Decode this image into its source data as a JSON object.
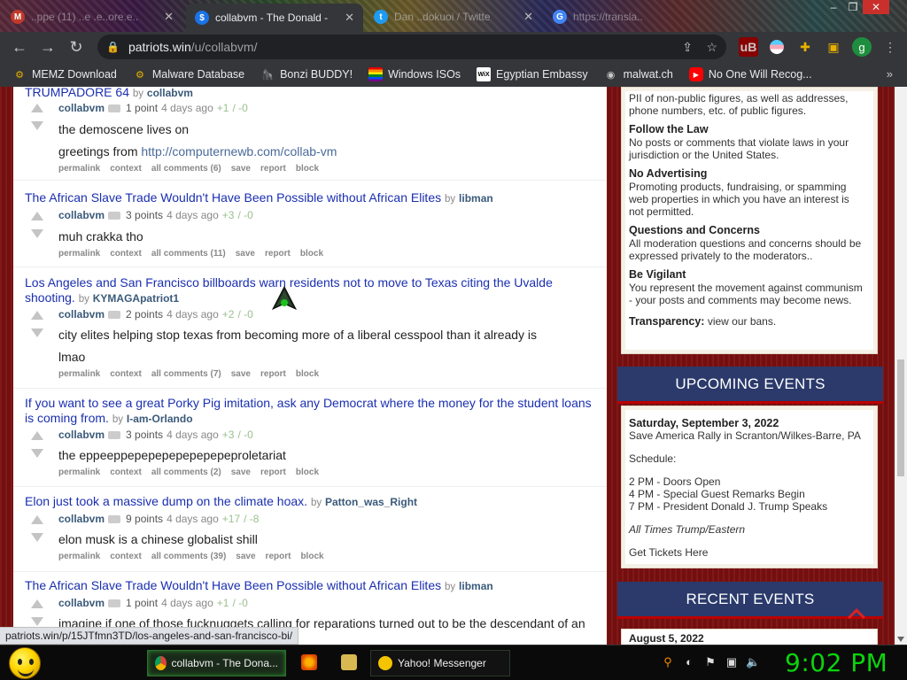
{
  "browser": {
    "tabs": [
      {
        "label": "..ppe (11) ..e .e..ore.e..",
        "active": false
      },
      {
        "label": "collabvm - The Donald -",
        "active": true
      },
      {
        "label": "Dan ..dokuoi / Twitte",
        "active": false
      },
      {
        "label": "https://transla..",
        "active": false
      }
    ],
    "url_host": "patriots.win",
    "url_path": "/u/collabvm/",
    "bookmarks": [
      {
        "label": "MEMZ Download",
        "icon": "memz-icon"
      },
      {
        "label": "Malware Database",
        "icon": "malware-icon"
      },
      {
        "label": "Bonzi BUDDY!",
        "icon": "bonzi-icon"
      },
      {
        "label": "Windows ISOs",
        "icon": "windows-icon"
      },
      {
        "label": "Egyptian Embassy",
        "icon": "wix-icon"
      },
      {
        "label": "malwat.ch",
        "icon": "globe-icon"
      },
      {
        "label": "No One Will Recog...",
        "icon": "youtube-icon"
      }
    ],
    "bookmarks_more": "»",
    "profile_initial": "g",
    "status_url": "patriots.win/p/15JTfmn3TD/los-angeles-and-san-francisco-bi/"
  },
  "comments": [
    {
      "post_title": "TRUMPADORE 64",
      "post_author": "collabvm",
      "user": "collabvm",
      "points": "1 point",
      "age": "4 days ago",
      "votes_up": "+1",
      "votes_down": "/ -0",
      "body_lines": [
        "the demoscene lives on"
      ],
      "link_prefix": "greetings from ",
      "link_text": "http://computernewb.com/collab-vm",
      "actions": [
        "permalink",
        "context",
        "all comments (6)",
        "save",
        "report",
        "block"
      ]
    },
    {
      "post_title": "The African Slave Trade Wouldn't Have Been Possible without African Elites",
      "post_author": "libman",
      "user": "collabvm",
      "points": "3 points",
      "age": "4 days ago",
      "votes_up": "+3",
      "votes_down": "/ -0",
      "body_lines": [
        "muh crakka tho"
      ],
      "actions": [
        "permalink",
        "context",
        "all comments (11)",
        "save",
        "report",
        "block"
      ]
    },
    {
      "post_title": "Los Angeles and San Francisco billboards warn residents not to move to Texas citing the Uvalde shooting.",
      "post_author": "KYMAGApatriot1",
      "user": "collabvm",
      "points": "2 points",
      "age": "4 days ago",
      "votes_up": "+2",
      "votes_down": "/ -0",
      "body_lines": [
        "city elites helping stop texas from becoming more of a liberal cesspool than it already is",
        "lmao"
      ],
      "actions": [
        "permalink",
        "context",
        "all comments (7)",
        "save",
        "report",
        "block"
      ]
    },
    {
      "post_title": "If you want to see a great Porky Pig imitation, ask any Democrat where the money for the student loans is coming from.",
      "post_author": "I-am-Orlando",
      "user": "collabvm",
      "points": "3 points",
      "age": "4 days ago",
      "votes_up": "+3",
      "votes_down": "/ -0",
      "body_lines": [
        "the eppeeppepepepepepepepeproletariat"
      ],
      "actions": [
        "permalink",
        "context",
        "all comments (2)",
        "save",
        "report",
        "block"
      ]
    },
    {
      "post_title": "Elon just took a massive dump on the climate hoax.",
      "post_author": "Patton_was_Right",
      "user": "collabvm",
      "points": "9 points",
      "age": "4 days ago",
      "votes_up": "+17",
      "votes_down": "/ -8",
      "body_lines": [
        "elon musk is a chinese globalist shill"
      ],
      "actions": [
        "permalink",
        "context",
        "all comments (39)",
        "save",
        "report",
        "block"
      ]
    },
    {
      "post_title": "The African Slave Trade Wouldn't Have Been Possible without African Elites",
      "post_author": "libman",
      "user": "collabvm",
      "points": "1 point",
      "age": "4 days ago",
      "votes_up": "+1",
      "votes_down": "/ -0",
      "body_lines": [
        "imagine if one of those fucknuggets calling for reparations turned out to be the descendant of an"
      ]
    }
  ],
  "by_word": "by",
  "sidebar": {
    "rules_partial": "PII of non-public figures, as well as addresses, phone numbers, etc. of public figures.",
    "rules": [
      {
        "title": "Follow the Law",
        "text": "No posts or comments that violate laws in your jurisdiction or the United States."
      },
      {
        "title": "No Advertising",
        "text": "Promoting products, fundraising, or spamming web properties in which you have an interest is not permitted."
      },
      {
        "title": "Questions and Concerns",
        "text": "All moderation questions and concerns should be expressed privately to the moderators.."
      },
      {
        "title": "Be Vigilant",
        "text": "You represent the movement against communism - your posts and comments may become news."
      }
    ],
    "transparency_label": "Transparency:",
    "transparency_link": "view our bans.",
    "upcoming_title": "UPCOMING EVENTS",
    "event_date": "Saturday, September 3, 2022",
    "event_name": "Save America Rally in Scranton/Wilkes-Barre, PA",
    "schedule_label": "Schedule:",
    "schedule": [
      "2 PM - Doors Open",
      "4 PM - Special Guest Remarks Begin",
      "7 PM - President Donald J. Trump Speaks"
    ],
    "times_note": "All Times Trump/Eastern",
    "tickets_link": "Get Tickets Here",
    "recent_title": "RECENT EVENTS",
    "recent_date": "August 5, 2022"
  },
  "taskbar": {
    "tasks": [
      {
        "label": "collabvm - The Dona...",
        "active": true
      },
      {
        "label": "Yahoo! Messenger",
        "active": false
      }
    ],
    "clock": "9:02 PM"
  }
}
